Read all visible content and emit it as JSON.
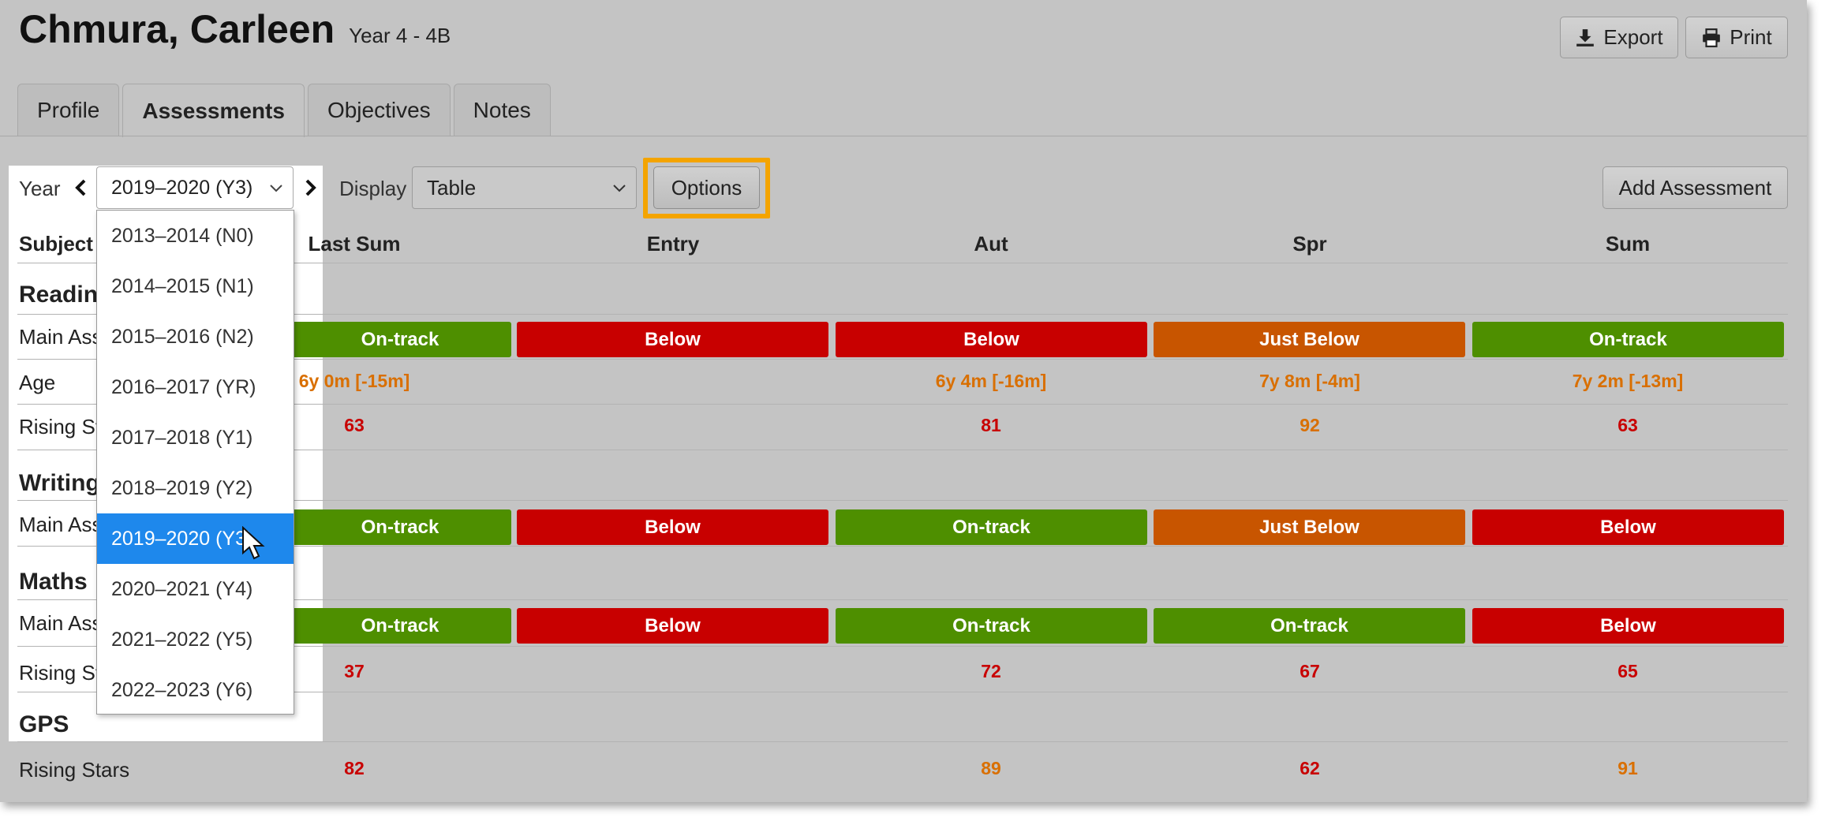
{
  "header": {
    "student_name": "Chmura, Carleen",
    "class_label": "Year 4 - 4B",
    "export_label": "Export",
    "print_label": "Print"
  },
  "tabs": [
    {
      "label": "Profile",
      "active": false
    },
    {
      "label": "Assessments",
      "active": true
    },
    {
      "label": "Objectives",
      "active": false
    },
    {
      "label": "Notes",
      "active": false
    }
  ],
  "filters": {
    "year_label": "Year",
    "year_value": "2019–2020 (Y3)",
    "display_label": "Display",
    "display_value": "Table",
    "options_label": "Options",
    "add_label": "Add Assessment"
  },
  "year_dropdown": {
    "options": [
      "2013–2014 (N0)",
      "2014–2015 (N1)",
      "2015–2016 (N2)",
      "2016–2017 (YR)",
      "2017–2018 (Y1)",
      "2018–2019 (Y2)",
      "2019–2020 (Y3)",
      "2020–2021 (Y4)",
      "2021–2022 (Y5)",
      "2022–2023 (Y6)"
    ],
    "selected_index": 6
  },
  "table": {
    "subject_header": "Subject",
    "columns": [
      "Last Sum",
      "Entry",
      "Aut",
      "Spr",
      "Sum"
    ],
    "sections": [
      {
        "title": "Reading",
        "title_visible": "Readin",
        "rows": [
          {
            "label": "Main Assessment",
            "label_visible": "Main Ass",
            "type": "pill",
            "cells": [
              "On-track",
              "Below",
              "Below",
              "Just Below",
              "On-track"
            ]
          },
          {
            "label": "Age",
            "label_visible": "Age",
            "type": "text",
            "cells": [
              "6y 0m [-15m]",
              "",
              "6y 4m [-16m]",
              "7y 8m [-4m]",
              "7y 2m [-13m]"
            ],
            "tones": [
              "orange",
              "",
              "orange",
              "orange",
              "orange"
            ]
          },
          {
            "label": "Rising Stars",
            "label_visible": "Rising St",
            "type": "text",
            "cells": [
              "63",
              "",
              "81",
              "92",
              "63"
            ],
            "tones": [
              "red",
              "",
              "red",
              "orange",
              "red"
            ]
          }
        ]
      },
      {
        "title": "Writing",
        "title_visible": "Writing",
        "rows": [
          {
            "label": "Main Assessment",
            "label_visible": "Main Ass",
            "type": "pill",
            "cells": [
              "On-track",
              "Below",
              "On-track",
              "Just Below",
              "Below"
            ]
          }
        ]
      },
      {
        "title": "Maths",
        "title_visible": "Maths",
        "rows": [
          {
            "label": "Main Assessment",
            "label_visible": "Main Ass",
            "type": "pill",
            "cells": [
              "On-track",
              "Below",
              "On-track",
              "On-track",
              "Below"
            ]
          },
          {
            "label": "Rising Stars",
            "label_visible": "Rising St",
            "type": "text",
            "cells": [
              "37",
              "",
              "72",
              "67",
              "65"
            ],
            "tones": [
              "red",
              "",
              "red",
              "red",
              "red"
            ]
          }
        ]
      },
      {
        "title": "GPS",
        "title_visible": "GPS",
        "rows": [
          {
            "label": "Rising Stars",
            "label_visible": "Rising Stars",
            "type": "text",
            "cells": [
              "82",
              "",
              "89",
              "62",
              "91"
            ],
            "tones": [
              "red",
              "",
              "orange",
              "red",
              "orange"
            ]
          }
        ]
      }
    ]
  },
  "colors": {
    "on_track": "#4e8f00",
    "below": "#c80000",
    "just_below": "#c85500",
    "text_red": "#c80000",
    "text_orange": "#d96f00",
    "highlight": "#f4a400",
    "selected": "#1e88ec"
  },
  "icons": {
    "export": "download-icon",
    "print": "printer-icon",
    "prev": "chevron-left-icon",
    "next": "chevron-right-icon",
    "caret": "chevron-down-icon",
    "cursor": "mouse-pointer-icon"
  }
}
